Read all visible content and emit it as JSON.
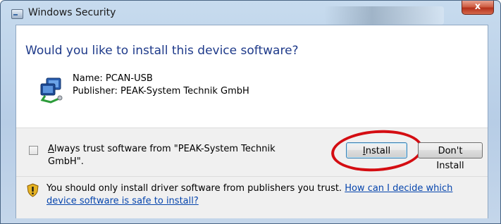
{
  "window": {
    "title": "Windows Security",
    "close_glyph": "x"
  },
  "dialog": {
    "heading": "Would you like to install this device software?",
    "device": {
      "name": "Name: PCAN-USB",
      "publisher": "Publisher: PEAK-System Technik GmbH",
      "icon": "network-device-icon"
    },
    "trust_checkbox": {
      "label": "Always trust software from \"PEAK-System Technik GmbH\".",
      "checked": false
    },
    "buttons": {
      "install": "Install",
      "dont_install": "Don't Install"
    },
    "warning": {
      "icon": "shield-icon",
      "text": "You should only install driver software from publishers you trust. ",
      "link": "How can I decide which device software is safe to install?"
    }
  },
  "annotation": {
    "color": "#d40d12"
  }
}
